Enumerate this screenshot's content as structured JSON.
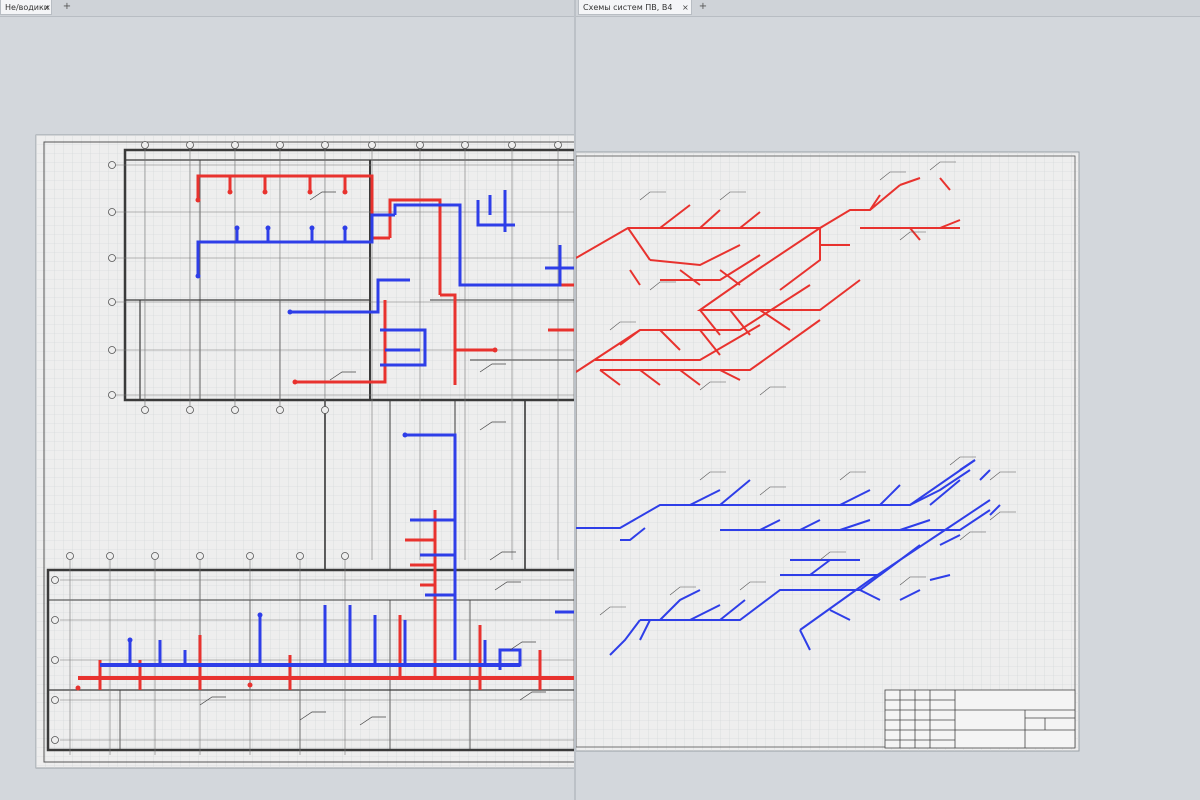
{
  "left_pane": {
    "tab": {
      "label": "Нe/водики",
      "close": "×",
      "add": "+"
    }
  },
  "right_pane": {
    "tab": {
      "label": "Схемы систем ПВ, В4",
      "close": "×",
      "add": "+"
    },
    "toolbar": {
      "buttons": [
        {
          "name": "undo-icon",
          "glyph": "↶"
        },
        {
          "name": "redo-icon",
          "glyph": "↷"
        },
        {
          "name": "zoom-icon",
          "glyph": "⊕"
        },
        {
          "name": "folder-icon",
          "glyph": "▬"
        },
        {
          "name": "save-icon",
          "glyph": "⎗"
        },
        {
          "name": "export-icon",
          "glyph": "⇨"
        },
        {
          "name": "print-icon",
          "glyph": "⎙"
        },
        {
          "name": "render-icon",
          "glyph": "◉"
        },
        {
          "name": "cut-icon",
          "glyph": "✂"
        },
        {
          "name": "copy-icon",
          "glyph": "❐"
        },
        {
          "name": "paste-icon",
          "glyph": "📋"
        },
        {
          "name": "view-icon",
          "glyph": "⬚"
        },
        {
          "name": "settings-icon",
          "glyph": "✎"
        },
        {
          "name": "help-icon",
          "glyph": "?"
        }
      ]
    }
  },
  "colors": {
    "supply_red": "#e8322e",
    "return_blue": "#2e3ee8",
    "grid": "#c9ccd0",
    "linework": "#3a3a3a",
    "paper": "#efefef"
  }
}
